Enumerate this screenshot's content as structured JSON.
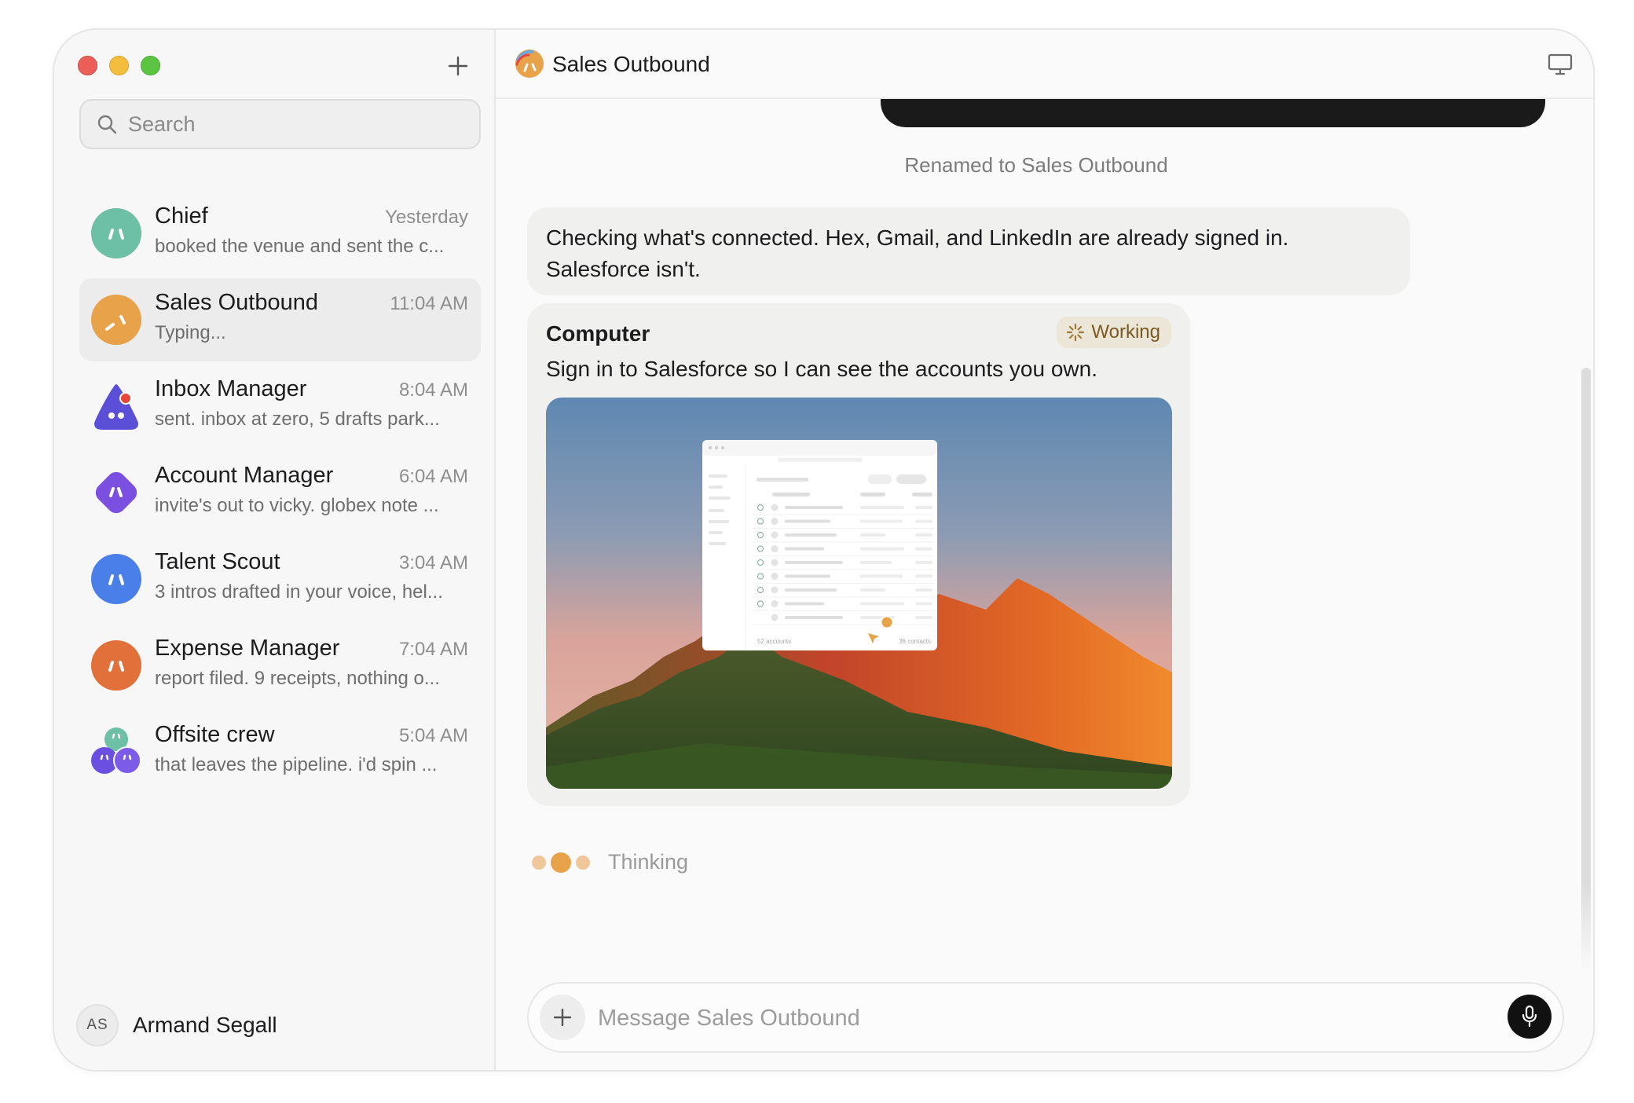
{
  "sidebar": {
    "search_placeholder": "Search",
    "conversations": [
      {
        "name": "Chief",
        "time": "Yesterday",
        "preview": "booked the venue and sent the c...",
        "avatar_color": "#6dbfa6",
        "active": false
      },
      {
        "name": "Sales Outbound",
        "time": "11:04 AM",
        "preview": "Typing...",
        "avatar_color": "#e8a24a",
        "active": true
      },
      {
        "name": "Inbox Manager",
        "time": "8:04 AM",
        "preview": "sent. inbox at zero, 5 drafts park...",
        "avatar_color": "#5b4fd8",
        "active": false
      },
      {
        "name": "Account Manager",
        "time": "6:04 AM",
        "preview": "invite's out to vicky. globex note ...",
        "avatar_color": "#7b4fe0",
        "active": false
      },
      {
        "name": "Talent Scout",
        "time": "3:04 AM",
        "preview": "3 intros drafted in your voice, hel...",
        "avatar_color": "#4a7ee8",
        "active": false
      },
      {
        "name": "Expense Manager",
        "time": "7:04 AM",
        "preview": "report filed. 9 receipts, nothing o...",
        "avatar_color": "#e2703a",
        "active": false
      },
      {
        "name": "Offsite crew",
        "time": "5:04 AM",
        "preview": "that leaves the pipeline. i'd spin ...",
        "avatar_color": "#7b5be8",
        "active": false
      }
    ],
    "user": {
      "initials": "AS",
      "name": "Armand Segall"
    }
  },
  "header": {
    "title": "Sales Outbound"
  },
  "chat": {
    "system_note": "Renamed to Sales Outbound",
    "message1": "Checking what's connected. Hex, Gmail, and LinkedIn are already signed in. Salesforce isn't.",
    "computer_card": {
      "title": "Computer",
      "status": "Working",
      "text": "Sign in to Salesforce so I can see the accounts you own.",
      "screenshot": {
        "footer_left": "52 accounts",
        "footer_right": "36 contacts"
      }
    },
    "thinking_label": "Thinking"
  },
  "composer": {
    "placeholder": "Message Sales Outbound"
  },
  "colors": {
    "accent": "#e8a24a",
    "working_text": "#7a5a22"
  }
}
